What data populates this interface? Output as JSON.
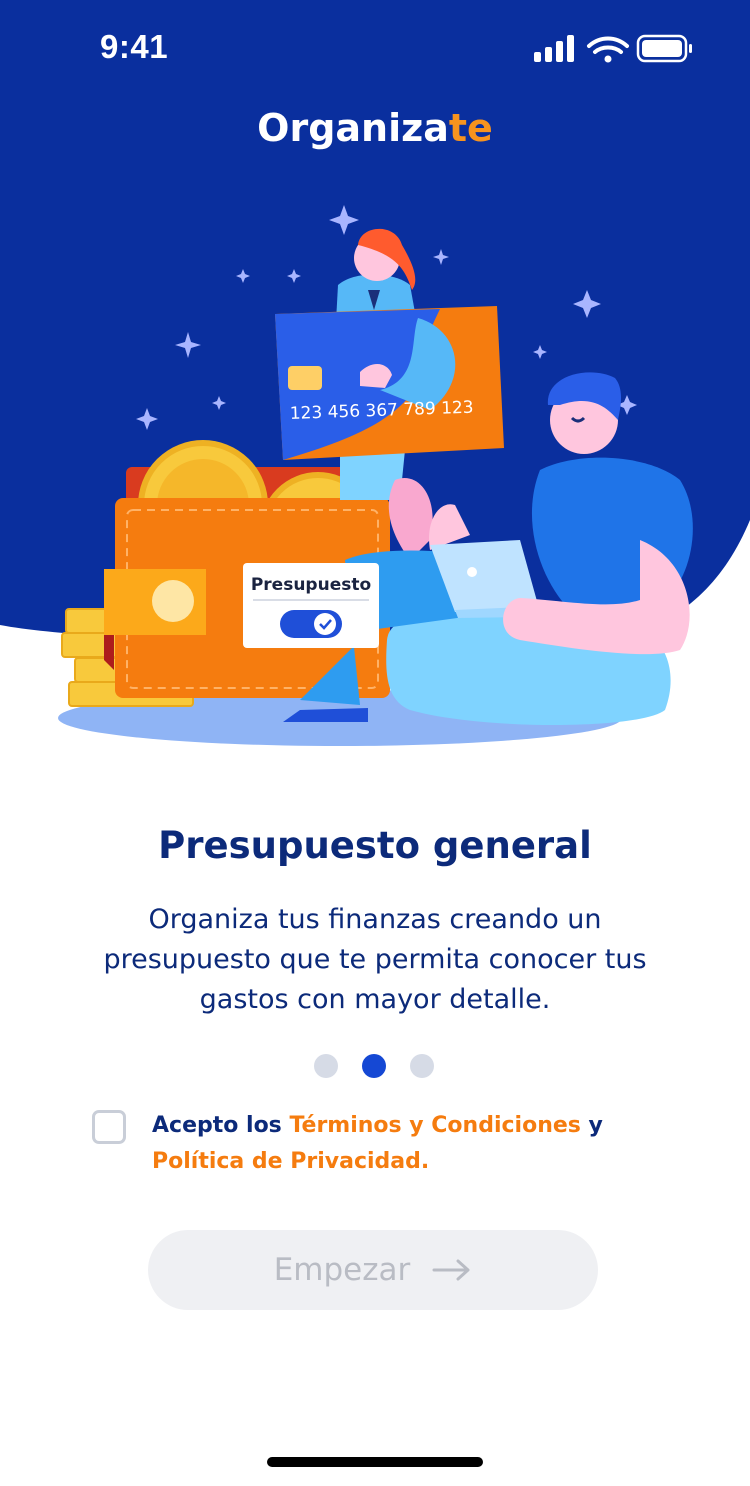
{
  "status_bar": {
    "time": "9:41"
  },
  "brand": {
    "main": "Organiza",
    "accent": "te"
  },
  "illustration": {
    "card_number": "123 456 367 789 123",
    "toggle_label": "Presupuesto"
  },
  "content": {
    "title": "Presupuesto general",
    "description": "Organiza tus finanzas creando un presupuesto que te permita conocer tus gastos con mayor detalle."
  },
  "pagination": {
    "total": 3,
    "active": 2
  },
  "terms": {
    "prefix": "Acepto los ",
    "link1": "Términos y Condiciones",
    "middle": " y ",
    "link2": "Política de Privacidad."
  },
  "cta": {
    "label": "Empezar",
    "icon": "arrow-right-icon"
  },
  "colors": {
    "primary_blue": "#0a2f9e",
    "accent_orange": "#f7931e",
    "text_navy": "#0c2a7a",
    "dot_active": "#1548d4"
  }
}
